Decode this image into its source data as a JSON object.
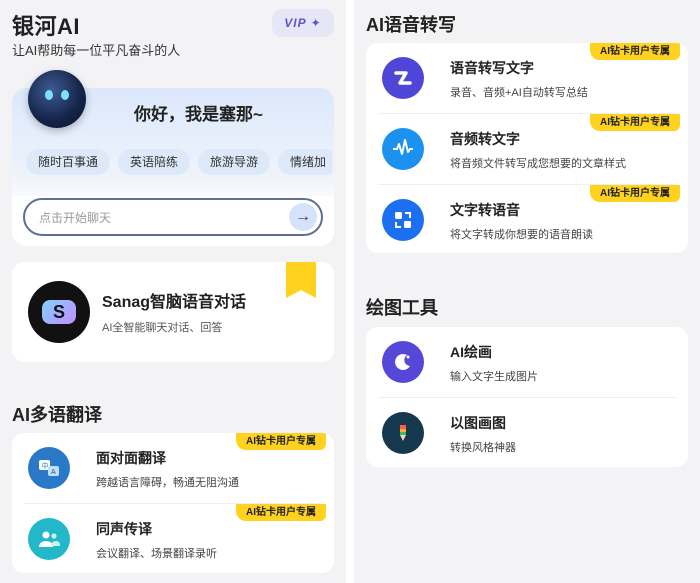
{
  "app": {
    "title": "银河AI",
    "subtitle": "让AI帮助每一位平凡奋斗的人",
    "vip_label": "VIP",
    "vip_star": "✦"
  },
  "hero": {
    "greeting": "你好，我是塞那~",
    "chips": [
      "随时百事通",
      "英语陪练",
      "旅游导游",
      "情绪加"
    ],
    "search_placeholder": "点击开始聊天",
    "send_glyph": "→"
  },
  "sanag": {
    "logo_letter": "S",
    "title": "Sanag智脑语音对话",
    "desc": "AI全智能聊天对话、回答"
  },
  "translate": {
    "section_title": "AI多语翻译",
    "items": [
      {
        "title": "面对面翻译",
        "desc": "跨越语言障碍，畅通无阻沟通",
        "badge": "AI钻卡用户专属",
        "color": "#2a78c8"
      },
      {
        "title": "同声传译",
        "desc": "会议翻译、场景翻译录听",
        "badge": "AI钻卡用户专属",
        "color": "#22b7c9"
      }
    ]
  },
  "transcribe": {
    "section_title": "AI语音转写",
    "items": [
      {
        "title": "语音转写文字",
        "desc": "录音、音频+AI自动转写总结",
        "badge": "AI钻卡用户专属",
        "color": "#4f45d6"
      },
      {
        "title": "音频转文字",
        "desc": "将音频文件转写成您想要的文章样式",
        "badge": "AI钻卡用户专属",
        "color": "#1c92f0"
      },
      {
        "title": "文字转语音",
        "desc": "将文字转成你想要的语音朗读",
        "badge": "AI钻卡用户专属",
        "color": "#1c6ff0"
      }
    ]
  },
  "drawing": {
    "section_title": "绘图工具",
    "items": [
      {
        "title": "AI绘画",
        "desc": "输入文字生成图片",
        "color": "#5548d8"
      },
      {
        "title": "以图画图",
        "desc": "转换风格神器",
        "color": "#16384f"
      }
    ]
  }
}
